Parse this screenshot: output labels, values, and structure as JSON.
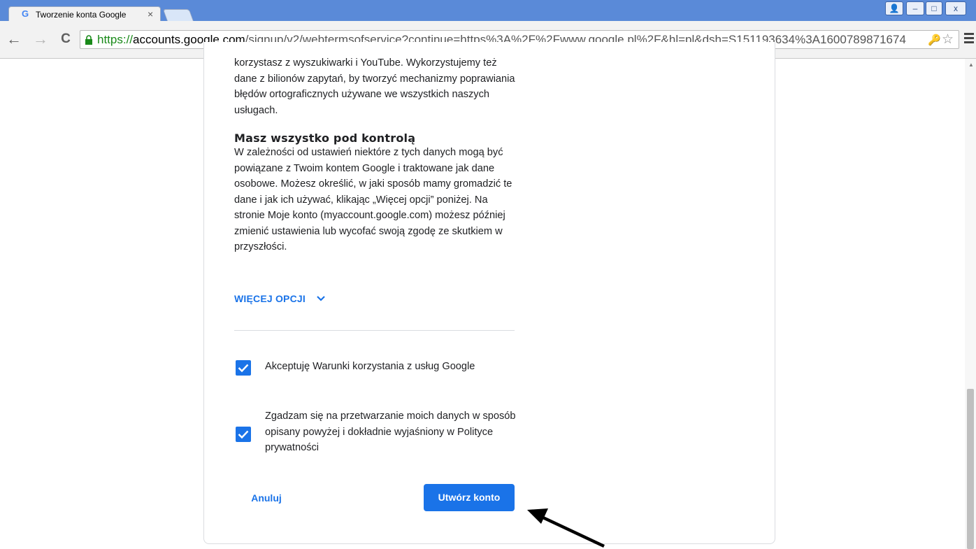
{
  "browser": {
    "tab_title": "Tworzenie konta Google",
    "tab_close": "×",
    "url_scheme": "https://",
    "url_host": "accounts.google.com",
    "url_path": "/signup/v2/webtermsofservice?continue=https%3A%2F%2Fwww.google.pl%2F&hl=pl&dsh=S151193634%3A1600789871674",
    "window_controls": [
      "👤",
      "–",
      "□",
      "x"
    ],
    "nav": {
      "back": "←",
      "forward": "→",
      "reload": "C"
    },
    "icons": {
      "lock": "lock-icon",
      "key": "key-icon",
      "star": "star-icon",
      "menu": "menu-icon"
    }
  },
  "content": {
    "paragraph_intro": "korzystasz z wyszukiwarki i YouTube. Wykorzystujemy też dane z bilionów zapytań, by tworzyć mechanizmy poprawiania błędów ortograficznych używane we wszystkich naszych usługach.",
    "heading": "Masz wszystko pod kontrolą",
    "paragraph_control": "W zależności od ustawień niektóre z tych danych mogą być powiązane z Twoim kontem Google i traktowane jak dane osobowe. Możesz określić, w jaki sposób mamy gromadzić te dane i jak ich używać, klikając „Więcej opcji” poniżej. Na stronie Moje konto (myaccount.google.com) możesz później zmienić ustawienia lub wycofać swoją zgodę ze skutkiem w przyszłości.",
    "more_options_label": "WIĘCEJ OPCJI",
    "checkbox_terms": {
      "label": "Akceptuję Warunki korzystania z usług Google",
      "checked": true
    },
    "checkbox_privacy": {
      "label": "Zgadzam się na przetwarzanie moich danych w sposób opisany powyżej i dokładnie wyjaśniony w Polityce prywatności",
      "checked": true
    },
    "cancel_label": "Anuluj",
    "create_label": "Utwórz konto"
  },
  "colors": {
    "accent": "#1a73e8",
    "titlebar": "#5a8ad8",
    "url_scheme": "#1a8a1a"
  }
}
